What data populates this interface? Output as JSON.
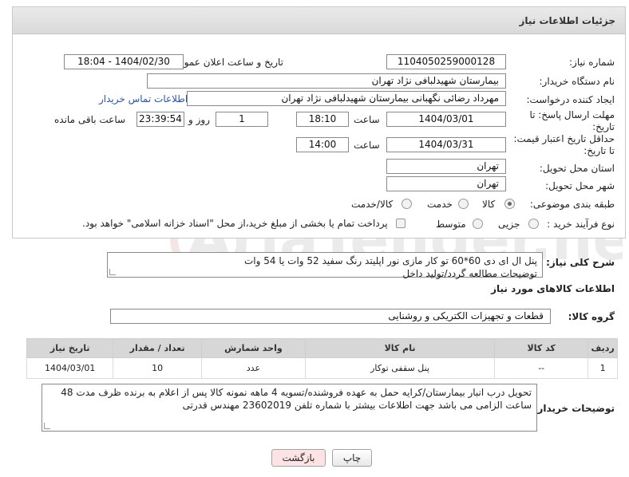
{
  "header": {
    "title": "جزئیات اطلاعات نیاز"
  },
  "form": {
    "need_number_label": "شماره نیاز:",
    "need_number": "1104050259000128",
    "announce_label": "تاریخ و ساعت اعلان عمومی:",
    "announce_value": "1404/02/30 - 18:04",
    "buyer_org_label": "نام دستگاه خریدار:",
    "buyer_org": "بیمارستان شهیدلبافی نژاد تهران",
    "creator_label": "ایجاد کننده درخواست:",
    "creator": "مهرداد رضائی نگهبانی بیمارستان شهیدلبافی نژاد تهران",
    "contact_link": "اطلاعات تماس خریدار",
    "deadline_label_1": "مهلت ارسال پاسخ: تا",
    "deadline_label_2": "تاریخ:",
    "deadline_date": "1404/03/01",
    "time_label": "ساعت",
    "deadline_time": "18:10",
    "days_value": "1",
    "days_label": "روز و",
    "remaining_time": "23:39:54",
    "remaining_label": "ساعت باقی مانده",
    "price_validity_label_1": "حداقل تاریخ اعتبار قیمت:",
    "price_validity_label_2": "تا تاریخ:",
    "validity_date": "1404/03/31",
    "validity_time": "14:00",
    "province_label": "استان محل تحویل:",
    "province": "تهران",
    "city_label": "شهر محل تحویل:",
    "city": "تهران",
    "category_label": "طبقه بندی موضوعی:",
    "category_options": [
      "کالا",
      "خدمت",
      "کالا/خدمت"
    ],
    "process_label": "نوع فرآیند خرید :",
    "process_options": [
      "جزیی",
      "متوسط"
    ],
    "payment_note": "پرداخت تمام یا بخشی از مبلغ خرید،از محل \"اسناد خزانه اسلامی\" خواهد بود."
  },
  "description": {
    "label": "شرح کلی نیاز:",
    "line1": "پنل ال ای دی 60*60 تو کار مازی نور اپلیتد رنگ سفید 52 وات یا 54 وات",
    "line2": "توضیحات مطالعه گردد/تولید داخل"
  },
  "goods": {
    "section_title": "اطلاعات کالاهای مورد نیاز",
    "group_label": "گروه کالا:",
    "group_value": "قطعات و تجهیزات الکتریکی و روشنایی",
    "columns": [
      "ردیف",
      "کد کالا",
      "نام کالا",
      "واحد شمارش",
      "تعداد / مقدار",
      "تاریخ نیاز"
    ],
    "rows": [
      {
        "row": "1",
        "code": "--",
        "name": "پنل سقفی توکار",
        "unit": "عدد",
        "qty": "10",
        "date": "1404/03/01"
      }
    ]
  },
  "buyer_notes": {
    "label": "توضیحات خریدار:",
    "text": "تحویل درب انبار بیمارستان/کرایه حمل به عهده فروشنده/تسویه 4 ماهه نمونه کالا پس از اعلام به برنده ظرف مدت 48 ساعت الزامی می باشد جهت اطلاعات بیشتر با شماره تلفن 23602019 مهندس قدرتی"
  },
  "buttons": {
    "print": "چاپ",
    "back": "بازگشت"
  },
  "watermark": {
    "text": "AriaTender.net"
  },
  "colors": {
    "link": "#2a55a8",
    "header_bg": "#dcdcdc",
    "back_button_bg": "#fde3e3"
  }
}
